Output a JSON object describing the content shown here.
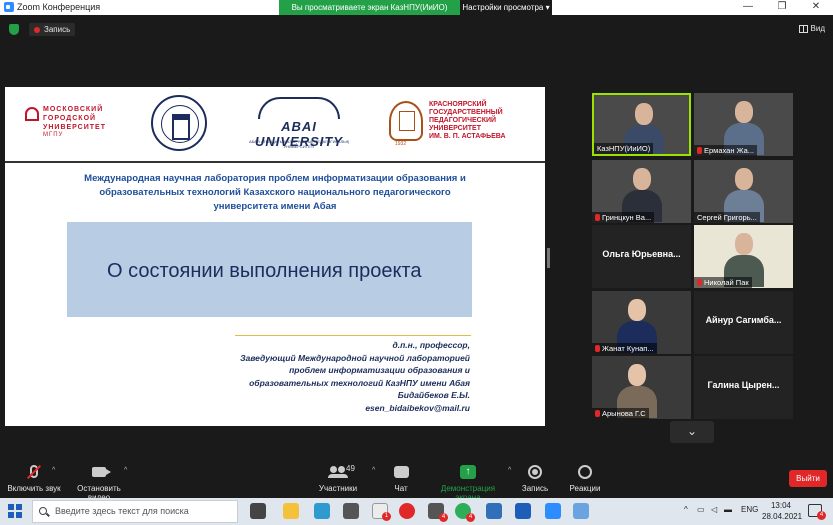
{
  "window": {
    "title": "Zoom Конференция",
    "share_message": "Вы просматриваете экран КазНПУ(ИиИО)",
    "view_options": "Настройки просмотра ▾",
    "controls": [
      "—",
      "❐",
      "✕"
    ]
  },
  "status": {
    "recording_label": "Запись",
    "view_label": "Вид"
  },
  "slide": {
    "mgpu_logo": [
      "МОСКОВСКИЙ",
      "ГОРОДСКОЙ",
      "УНИВЕРСИТЕТ"
    ],
    "mgpu_sub": "МГПУ",
    "abai_logo": "ABAI UNIVERSITY",
    "abai_sub": "АБАЙ АТЫНДАҒЫ ҚАЗАҚ ҰЛТТЫҚ ПЕДАГОГИКАЛЫҚ УНИВЕРСИТЕТІ",
    "kgpu_logo": [
      "КРАСНОЯРСКИЙ",
      "ГОСУДАРСТВЕННЫЙ",
      "ПЕДАГОГИЧЕСКИЙ",
      "УНИВЕРСИТЕТ",
      "ИМ. В. П. АСТАФЬЕВА"
    ],
    "kgpu_year": "1932",
    "lab_title": [
      "Международная научная лаборатория проблем информатизации образования и",
      "образовательных технологий Казахского национального педагогического",
      "университета имени Абая"
    ],
    "project_title": "О состоянии выполнения проекта",
    "author": [
      "д.п.н., профессор,",
      "Заведующий Международной научной лабораторией",
      "проблем информатизации образования и",
      "образовательных технологий КазНПУ имени Абая",
      "Бидайбеков Е.Ы.",
      "esen_bidaibekov@mail.ru"
    ]
  },
  "participants": [
    {
      "name": "КазНПУ(ИиИО)",
      "video": true,
      "muted": false,
      "active": true
    },
    {
      "name": "Ермахан Жа...",
      "video": true,
      "muted": true,
      "active": false
    },
    {
      "name": "Гринцкун Ва...",
      "video": true,
      "muted": true,
      "active": false
    },
    {
      "name": "Сергей Григорь...",
      "video": true,
      "muted": false,
      "active": false
    },
    {
      "name": "Ольга Юрьевна...",
      "video": false,
      "muted": false,
      "active": false
    },
    {
      "name": "Николай Пак",
      "video": true,
      "muted": true,
      "active": false
    },
    {
      "name": "Жанат Кунап...",
      "video": true,
      "muted": true,
      "active": false
    },
    {
      "name": "Айнур Сагимба...",
      "video": false,
      "muted": true,
      "active": false
    },
    {
      "name": "Арынова Г.С",
      "video": true,
      "muted": true,
      "active": false
    },
    {
      "name": "Галина Цырен...",
      "video": false,
      "muted": true,
      "active": false
    }
  ],
  "toolbar": {
    "unmute": "Включить звук",
    "start_video": "Остановить видео",
    "participants": "Участники",
    "participants_count": "49",
    "chat": "Чат",
    "share": "Демонстрация экрана",
    "record": "Запись",
    "reactions": "Реакции",
    "leave": "Выйти"
  },
  "taskbar": {
    "search_placeholder": "Введите здесь текст для поиска",
    "badge_1": "1",
    "badge_4": "4",
    "badge_4b": "4",
    "lang": "ENG",
    "time": "13:04",
    "date": "28.04.2021",
    "notif_badge": "4"
  },
  "colors": {
    "share_green": "#24a148",
    "leave_red": "#e02828",
    "active_speaker": "#9be200",
    "slide_blue": "#1f4e99",
    "project_box": "#b8cce4"
  }
}
